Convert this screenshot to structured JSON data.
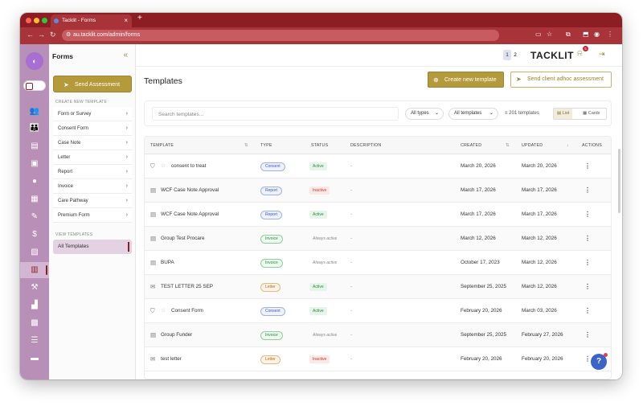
{
  "browser": {
    "tab_title": "Tacklit - Forms",
    "url": "au.tacklit.com/admin/forms"
  },
  "sidebar": {
    "title": "Forms",
    "send_assessment": "Send Assessment",
    "create_heading": "CREATE NEW TEMPLATE",
    "create_items": [
      "Form or Survey",
      "Consent Form",
      "Case Note",
      "Letter",
      "Report",
      "Invoice",
      "Care Pathway",
      "Premium Form"
    ],
    "view_heading": "VIEW TEMPLATES",
    "all_templates": "All Templates"
  },
  "header": {
    "pages": [
      "1",
      "2"
    ],
    "brand": "TACKLIT",
    "notification_count": "5"
  },
  "page": {
    "title": "Templates",
    "create_button": "Create new template",
    "adhoc_button": "Send client adhoc assessment"
  },
  "filters": {
    "search_placeholder": "Search templates...",
    "types": "All types",
    "templates": "All templates",
    "count": "201 templates",
    "view_list": "List",
    "view_cards": "Cards"
  },
  "table": {
    "headers": [
      "TEMPLATE",
      "TYPE",
      "STATUS",
      "DESCRIPTION",
      "CREATED",
      "UPDATED",
      "ACTIONS"
    ],
    "rows": [
      {
        "name": "consent to treat",
        "type": "Consent",
        "status": "Active",
        "desc": "-",
        "created": "March 20, 2026",
        "updated": "March 20, 2026"
      },
      {
        "name": "WCF Case Note Approval",
        "type": "Report",
        "status": "Inactive",
        "desc": "-",
        "created": "March 17, 2026",
        "updated": "March 17, 2026"
      },
      {
        "name": "WCF Case Note Approval",
        "type": "Report",
        "status": "Active",
        "desc": "-",
        "created": "March 17, 2026",
        "updated": "March 17, 2026"
      },
      {
        "name": "Group Test Procare",
        "type": "Invoice",
        "status": "Always active",
        "desc": "-",
        "created": "March 12, 2026",
        "updated": "March 12, 2026"
      },
      {
        "name": "BUPA",
        "type": "Invoice",
        "status": "Always active",
        "desc": "-",
        "created": "October 17, 2023",
        "updated": "March 12, 2026"
      },
      {
        "name": "TEST LETTER 25 SEP",
        "type": "Letter",
        "status": "Active",
        "desc": "-",
        "created": "September 25, 2025",
        "updated": "March 12, 2026"
      },
      {
        "name": "Consent Form",
        "type": "Consent",
        "status": "Active",
        "desc": "-",
        "created": "February 20, 2026",
        "updated": "March 03, 2026"
      },
      {
        "name": "Group Funder",
        "type": "Invoice",
        "status": "Always active",
        "desc": "-",
        "created": "September 25, 2025",
        "updated": "February 27, 2026"
      },
      {
        "name": "test letter",
        "type": "Letter",
        "status": "Inactive",
        "desc": "-",
        "created": "February 20, 2026",
        "updated": "February 20, 2026"
      }
    ]
  },
  "colors": {
    "brand_dark": "#8c1d22",
    "accent_gold": "#b49a3a",
    "rail": "#b88fb6"
  }
}
